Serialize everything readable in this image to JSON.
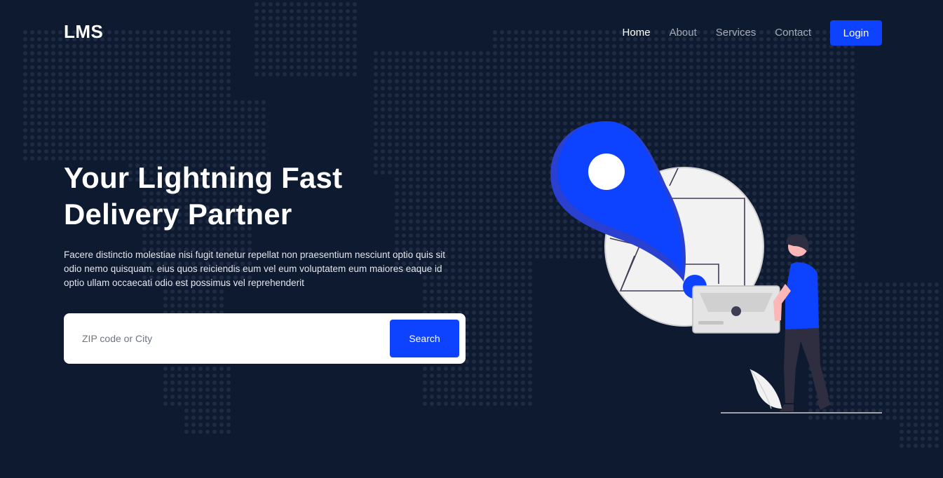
{
  "brand": {
    "logo_text": "LMS"
  },
  "nav": {
    "items": [
      {
        "label": "Home",
        "active": true
      },
      {
        "label": "About",
        "active": false
      },
      {
        "label": "Services",
        "active": false
      },
      {
        "label": "Contact",
        "active": false
      }
    ],
    "login_label": "Login"
  },
  "hero": {
    "title": "Your Lightning Fast Delivery Partner",
    "description": "Facere distinctio molestiae nisi fugit tenetur repellat non praesentium nesciunt optio quis sit odio nemo quisquam. eius quos reiciendis eum vel eum voluptatem eum maiores eaque id optio ullam occaecati odio est possimus vel reprehenderit"
  },
  "search": {
    "placeholder": "ZIP code or City",
    "value": "",
    "button_label": "Search"
  },
  "colors": {
    "background": "#0e1a30",
    "accent": "#0d42ff",
    "map_dots": "#1e2a40"
  }
}
